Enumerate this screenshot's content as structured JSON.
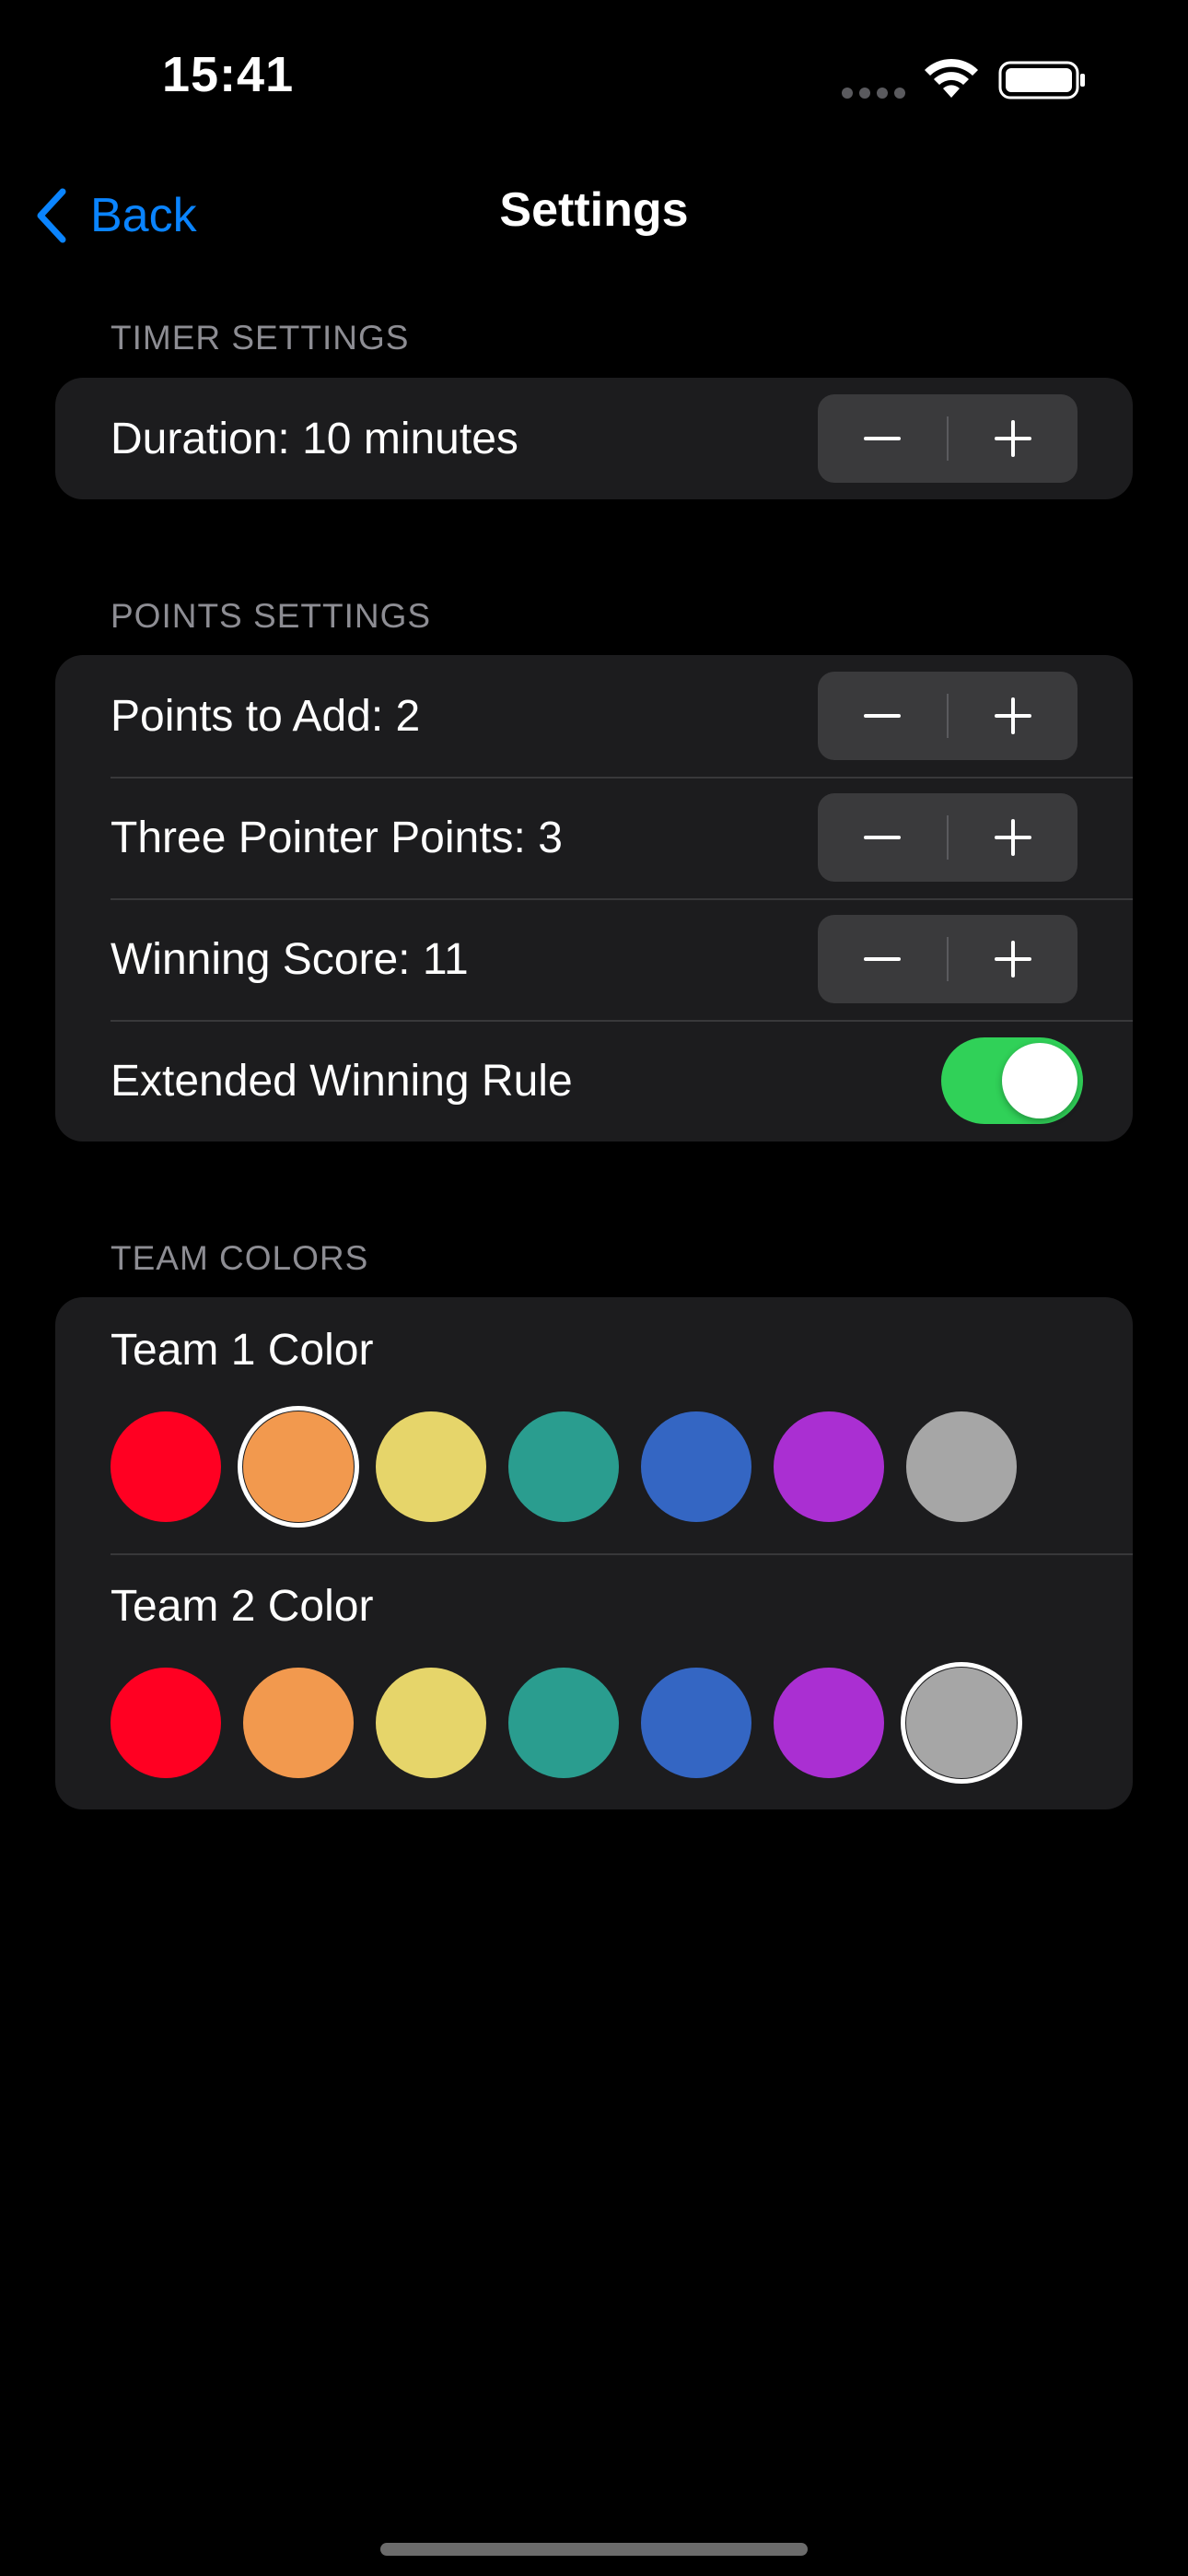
{
  "status_bar": {
    "time": "15:41",
    "icons": [
      "signal-icon",
      "wifi-icon",
      "battery-icon"
    ]
  },
  "nav": {
    "back_label": "Back",
    "title": "Settings",
    "accent_color": "#0a84ff"
  },
  "timer_settings": {
    "header": "TIMER SETTINGS",
    "rows": [
      {
        "label": "Duration: 10 minutes",
        "control": "stepper"
      }
    ]
  },
  "points_settings": {
    "header": "POINTS SETTINGS",
    "rows": [
      {
        "label": "Points to Add: 2",
        "control": "stepper"
      },
      {
        "label": "Three Pointer Points: 3",
        "control": "stepper"
      },
      {
        "label": "Winning Score: 11",
        "control": "stepper"
      },
      {
        "label": "Extended Winning Rule",
        "control": "toggle",
        "value": true
      }
    ]
  },
  "team_colors": {
    "header": "TEAM COLORS",
    "palette": [
      "#ff0022",
      "#f2994e",
      "#e6d56a",
      "#2a9d8f",
      "#3466c3",
      "#aa2fd2",
      "#a6a6a6"
    ],
    "teams": [
      {
        "label": "Team 1 Color",
        "selected_index": 1
      },
      {
        "label": "Team 2 Color",
        "selected_index": 6
      }
    ]
  },
  "colors": {
    "background": "#000000",
    "card": "#1c1c1e",
    "toggle_on": "#30d158",
    "section_header": "#8d8d93"
  }
}
